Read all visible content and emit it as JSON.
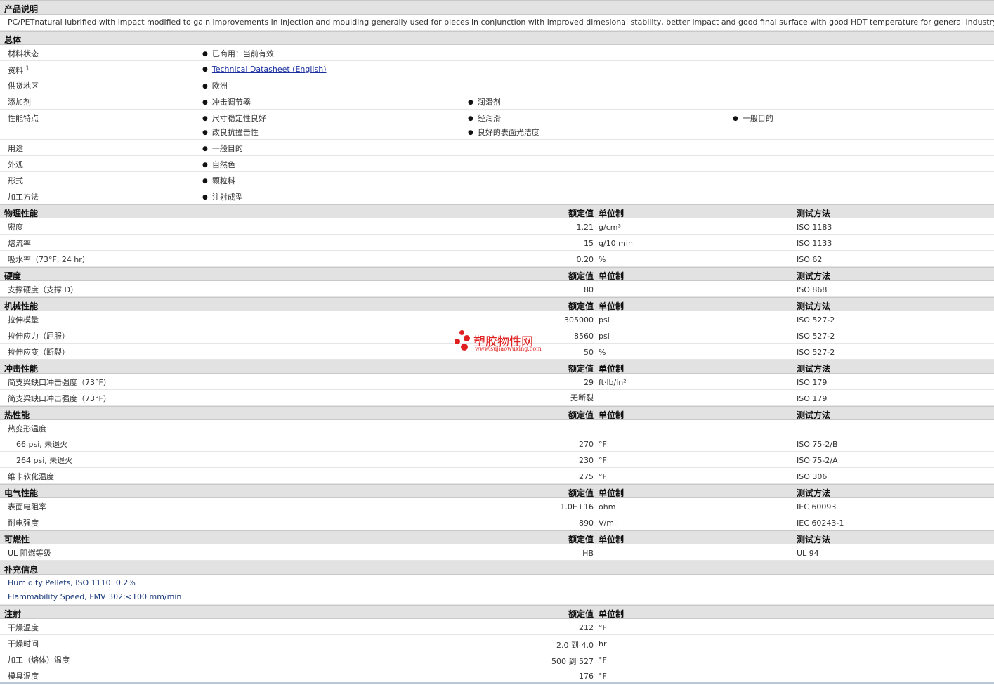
{
  "desc": {
    "header": "产品说明",
    "text": "PC/PETnatural lubrified with impact modified to gain improvements in injection and moulding generally used for pieces in conjunction with improved dimesional stability, better impact and good final surface with good HDT temperature for general industry."
  },
  "general": {
    "header": "总体",
    "status_label": "材料状态",
    "status": "已商用：当前有效",
    "source_label": "资料",
    "source_sup": "1",
    "source_link": "Technical Datasheet (English)",
    "region_label": "供货地区",
    "region": "欧洲",
    "additive_label": "添加剂",
    "additive_1": "冲击调节器",
    "additive_2": "润滑剂",
    "features_label": "性能特点",
    "feature_1": "尺寸稳定性良好",
    "feature_2": "经润滑",
    "feature_3": "一般目的",
    "feature_4": "改良抗撞击性",
    "feature_5": "良好的表面光洁度",
    "use_label": "用途",
    "use": "一般目的",
    "appearance_label": "外观",
    "appearance": "自然色",
    "form_label": "形式",
    "form": "颗粒料",
    "method_label": "加工方法",
    "method": "注射成型"
  },
  "cols": {
    "value": "额定值",
    "unit": "单位制",
    "test": "测试方法"
  },
  "physical": {
    "header": "物理性能",
    "rows": [
      {
        "label": "密度",
        "value": "1.21",
        "unit": "g/cm³",
        "test": "ISO 1183"
      },
      {
        "label": "熔流率",
        "value": "15",
        "unit": "g/10 min",
        "test": "ISO 1133"
      },
      {
        "label": "吸水率（73°F, 24 hr）",
        "value": "0.20",
        "unit": "%",
        "test": "ISO 62"
      }
    ]
  },
  "hardness": {
    "header": "硬度",
    "rows": [
      {
        "label": "支撑硬度（支撑 D）",
        "value": "80",
        "unit": "",
        "test": "ISO 868"
      }
    ]
  },
  "mechanical": {
    "header": "机械性能",
    "rows": [
      {
        "label": "拉伸模量",
        "value": "305000",
        "unit": "psi",
        "test": "ISO 527-2"
      },
      {
        "label": "拉伸应力（屈服）",
        "value": "8560",
        "unit": "psi",
        "test": "ISO 527-2"
      },
      {
        "label": "拉伸应变（断裂）",
        "value": "50",
        "unit": "%",
        "test": "ISO 527-2"
      }
    ]
  },
  "impact": {
    "header": "冲击性能",
    "rows": [
      {
        "label": "简支梁缺口冲击强度（73°F）",
        "value": "29",
        "unit": "ft·lb/in²",
        "test": "ISO 179"
      },
      {
        "label": "简支梁缺口冲击强度（73°F）",
        "value": "无断裂",
        "unit": "",
        "test": "ISO 179"
      }
    ]
  },
  "thermal": {
    "header": "热性能",
    "hdt_label": "热变形温度",
    "rows": [
      {
        "label": "66 psi, 未退火",
        "value": "270",
        "unit": "°F",
        "test": "ISO 75-2/B"
      },
      {
        "label": "264 psi, 未退火",
        "value": "230",
        "unit": "°F",
        "test": "ISO 75-2/A"
      },
      {
        "label": "维卡软化温度",
        "value": "275",
        "unit": "°F",
        "test": "ISO 306"
      }
    ]
  },
  "electrical": {
    "header": "电气性能",
    "rows": [
      {
        "label": "表面电阻率",
        "value": "1.0E+16",
        "unit": "ohm",
        "test": "IEC 60093"
      },
      {
        "label": "耐电强度",
        "value": "890",
        "unit": "V/mil",
        "test": "IEC 60243-1"
      }
    ]
  },
  "flammability": {
    "header": "可燃性",
    "rows": [
      {
        "label": "UL 阻燃等级",
        "value": "HB",
        "unit": "",
        "test": "UL 94"
      }
    ]
  },
  "supplement": {
    "header": "补充信息",
    "line_1": "Humidity Pellets, ISO 1110: 0.2%",
    "line_2": "Flammability Speed, FMV 302:<100 mm/min"
  },
  "injection": {
    "header": "注射",
    "rows": [
      {
        "label": "干燥温度",
        "value": "212",
        "unit": "°F"
      },
      {
        "label": "干燥时间",
        "value": "2.0 到  4.0",
        "unit": "hr"
      },
      {
        "label": "加工（熔体）温度",
        "value": "500 到  527",
        "unit": "°F"
      },
      {
        "label": "模具温度",
        "value": "176",
        "unit": "°F"
      }
    ]
  },
  "watermark": {
    "cn": "塑胶物性网",
    "en": "www.sujiaowuxing.com"
  }
}
